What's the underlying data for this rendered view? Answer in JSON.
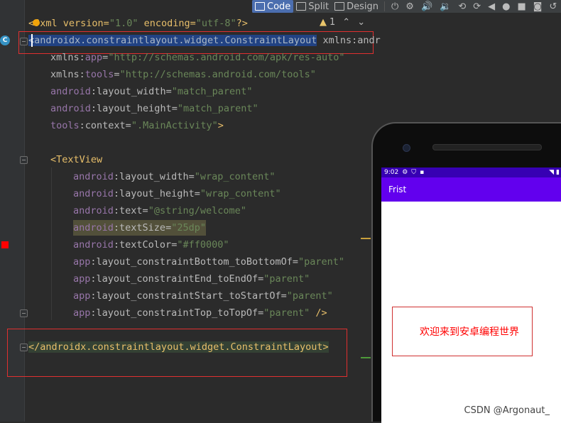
{
  "toolbar": {
    "code_label": "Code",
    "split_label": "Split",
    "design_label": "Design",
    "device_icons": [
      "power-icon",
      "settings-icon",
      "volume-up-icon",
      "volume-down-icon",
      "rotate-icon",
      "rotate-alt-icon",
      "back-icon",
      "home-icon",
      "overview-icon",
      "camera-icon",
      "undo-icon"
    ]
  },
  "inspection": {
    "warning_count": "1"
  },
  "code": {
    "line1": {
      "p1": "<",
      "p2": "?xml version=",
      "p3": "\"1.0\"",
      "p4": " encoding=",
      "p5": "\"utf-8\"",
      "p6": "?>"
    },
    "line2": {
      "open": "<",
      "tag": "androidx.constraintlayout.widget.ConstraintLayout",
      "rest": " xmlns:andr"
    },
    "line3": {
      "ns": "xmlns:",
      "attr": "app",
      "eq": "=",
      "val": "\"http://schemas.android.com/apk/res-auto\""
    },
    "line4": {
      "ns": "xmlns:",
      "attr": "tools",
      "eq": "=",
      "val": "\"http://schemas.android.com/tools\""
    },
    "line5": {
      "ns": "android",
      "attr": ":layout_width",
      "eq": "=",
      "val": "\"match_parent\""
    },
    "line6": {
      "ns": "android",
      "attr": ":layout_height",
      "eq": "=",
      "val": "\"match_parent\""
    },
    "line7": {
      "ns": "tools",
      "attr": ":context",
      "eq": "=",
      "val": "\".MainActivity\"",
      "end": ">"
    },
    "line8": {
      "tag": "<TextView"
    },
    "line9": {
      "ns": "android",
      "attr": ":layout_width",
      "eq": "=",
      "val": "\"wrap_content\""
    },
    "line10": {
      "ns": "android",
      "attr": ":layout_height",
      "eq": "=",
      "val": "\"wrap_content\""
    },
    "line11": {
      "ns": "android",
      "attr": ":text",
      "eq": "=",
      "val": "\"@string/welcome\""
    },
    "line12": {
      "ns": "android",
      "attr": ":textSize",
      "eq": "=",
      "val": "\"25dp\""
    },
    "line13": {
      "ns": "android",
      "attr": ":textColor",
      "eq": "=",
      "val": "\"#ff0000\""
    },
    "line14": {
      "ns": "app",
      "attr": ":layout_constraintBottom_toBottomOf",
      "eq": "=",
      "val": "\"parent\""
    },
    "line15": {
      "ns": "app",
      "attr": ":layout_constraintEnd_toEndOf",
      "eq": "=",
      "val": "\"parent\""
    },
    "line16": {
      "ns": "app",
      "attr": ":layout_constraintStart_toStartOf",
      "eq": "=",
      "val": "\"parent\""
    },
    "line17": {
      "ns": "app",
      "attr": ":layout_constraintTop_toTopOf",
      "eq": "=",
      "val": "\"parent\"",
      "end": " />"
    },
    "line18": {
      "tag": "</androidx.constraintlayout.widget.ConstraintLayout>"
    }
  },
  "device": {
    "time": "9:02",
    "app_title": "Frist",
    "welcome_text": "欢迎来到安卓编程世界"
  },
  "watermark": "CSDN @Argonaut_",
  "colors": {
    "status_bar": "#3700b3",
    "app_bar": "#6200ee",
    "welcome_text": "#ff0000",
    "annotation_box": "#e03030"
  }
}
